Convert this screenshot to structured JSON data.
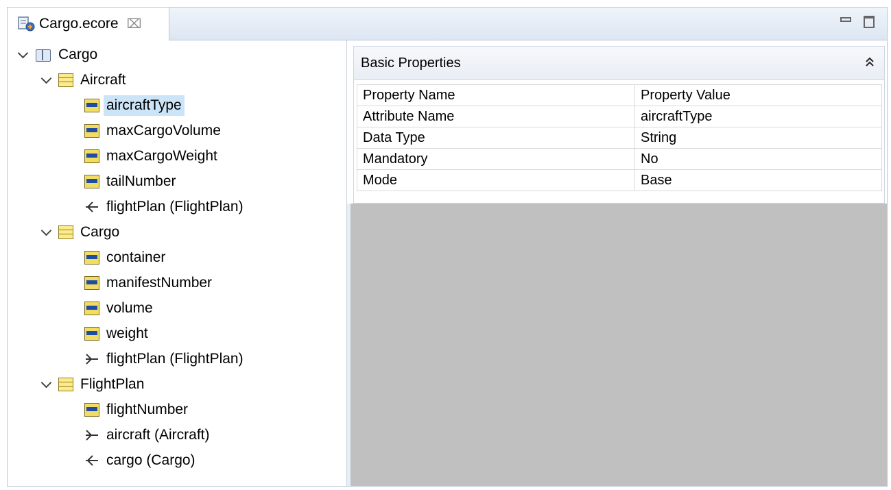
{
  "tab": {
    "label": "Cargo.ecore",
    "close_glyph": "⌧"
  },
  "tree": {
    "rows": [
      {
        "label": "Cargo",
        "kind": "package",
        "level": 0,
        "expanded": true
      },
      {
        "label": "Aircraft",
        "kind": "class",
        "level": 1,
        "expanded": true
      },
      {
        "label": "aircraftType",
        "kind": "attribute",
        "level": 2,
        "selected": true
      },
      {
        "label": "maxCargoVolume",
        "kind": "attribute",
        "level": 2
      },
      {
        "label": "maxCargoWeight",
        "kind": "attribute",
        "level": 2
      },
      {
        "label": "tailNumber",
        "kind": "attribute",
        "level": 2
      },
      {
        "label": "flightPlan (FlightPlan)",
        "kind": "reference-in",
        "level": 2
      },
      {
        "label": "Cargo",
        "kind": "class",
        "level": 1,
        "expanded": true
      },
      {
        "label": "container",
        "kind": "attribute",
        "level": 2
      },
      {
        "label": "manifestNumber",
        "kind": "attribute",
        "level": 2
      },
      {
        "label": "volume",
        "kind": "attribute",
        "level": 2
      },
      {
        "label": "weight",
        "kind": "attribute",
        "level": 2
      },
      {
        "label": "flightPlan (FlightPlan)",
        "kind": "reference-out",
        "level": 2
      },
      {
        "label": "FlightPlan",
        "kind": "class",
        "level": 1,
        "expanded": true
      },
      {
        "label": "flightNumber",
        "kind": "attribute",
        "level": 2
      },
      {
        "label": "aircraft (Aircraft)",
        "kind": "reference-out",
        "level": 2
      },
      {
        "label": "cargo (Cargo)",
        "kind": "reference-in",
        "level": 2
      }
    ]
  },
  "properties": {
    "section_title": "Basic Properties",
    "columns": [
      "Property Name",
      "Property Value"
    ],
    "rows": [
      [
        "Attribute Name",
        "aircraftType"
      ],
      [
        "Data Type",
        "String"
      ],
      [
        "Mandatory",
        "No"
      ],
      [
        "Mode",
        "Base"
      ]
    ]
  },
  "colors": {
    "selection": "#cce4f7",
    "empty_area": "#c0c0c0",
    "tab_bar": "#dce6f2"
  }
}
